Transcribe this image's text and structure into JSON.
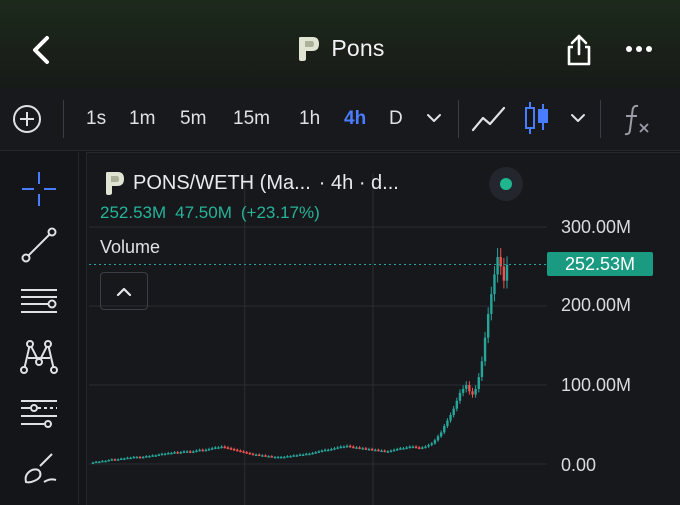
{
  "header": {
    "title": "Pons",
    "back_icon": "chevron-left-icon",
    "share_icon": "share-icon",
    "more_icon": "more-horizontal-icon"
  },
  "toolbar": {
    "timeframes": [
      "1s",
      "1m",
      "5m",
      "15m",
      "1h",
      "4h",
      "D"
    ],
    "active_timeframe": "4h",
    "icons": [
      "add-indicator-icon",
      "chevron-down-icon",
      "line-chart-icon",
      "candlestick-icon",
      "chevron-down-icon",
      "function-icon"
    ]
  },
  "left_tools": [
    "crosshair-icon",
    "trend-line-icon",
    "horizontal-lines-icon",
    "pattern-icon",
    "fib-levels-icon",
    "brush-icon"
  ],
  "chart": {
    "symbol": "PONS/WETH (Ma...",
    "interval_text": "· 4h · d...",
    "ohlc": {
      "value": "252.53M",
      "change": "47.50M",
      "change_pct": "(+23.17%)"
    },
    "volume_label": "Volume",
    "current_price_tag": "252.53M",
    "colors": {
      "up": "#26a69a",
      "down": "#ef5350",
      "accent": "#4a7cff",
      "tag": "#1b9a82"
    }
  },
  "chart_data": {
    "type": "candlestick",
    "y_ticks": [
      "300.00M",
      "200.00M",
      "100.00M",
      "0.00"
    ],
    "ylim": [
      0,
      300000000
    ],
    "last_value": 252530000,
    "grid": true,
    "series": [
      {
        "values": [
          2,
          3,
          3,
          4,
          4,
          5,
          6,
          5,
          6,
          7,
          7,
          8,
          8,
          9,
          9,
          8,
          9,
          10,
          10,
          11,
          11,
          12,
          13,
          13,
          14,
          14,
          15,
          14,
          15,
          16,
          16,
          15,
          16,
          17,
          18,
          17,
          18,
          19,
          20,
          21,
          21,
          22,
          21,
          20,
          19,
          18,
          17,
          16,
          15,
          14,
          13,
          12,
          12,
          11,
          11,
          10,
          10,
          9,
          9,
          9,
          9,
          9,
          10,
          10,
          11,
          11,
          12,
          12,
          13,
          13,
          14,
          15,
          16,
          17,
          18,
          18,
          19,
          20,
          21,
          22,
          22,
          23,
          22,
          21,
          21,
          20,
          20,
          19,
          19,
          18,
          18,
          17,
          17,
          16,
          16,
          17,
          18,
          19,
          20,
          20,
          21,
          22,
          22,
          21,
          20,
          21,
          22,
          24,
          26,
          30,
          35,
          40,
          48,
          55,
          62,
          70,
          80,
          90,
          95,
          100,
          92,
          88,
          95,
          110,
          130,
          160,
          190,
          215,
          240,
          262,
          250,
          232,
          252
        ]
      }
    ]
  }
}
